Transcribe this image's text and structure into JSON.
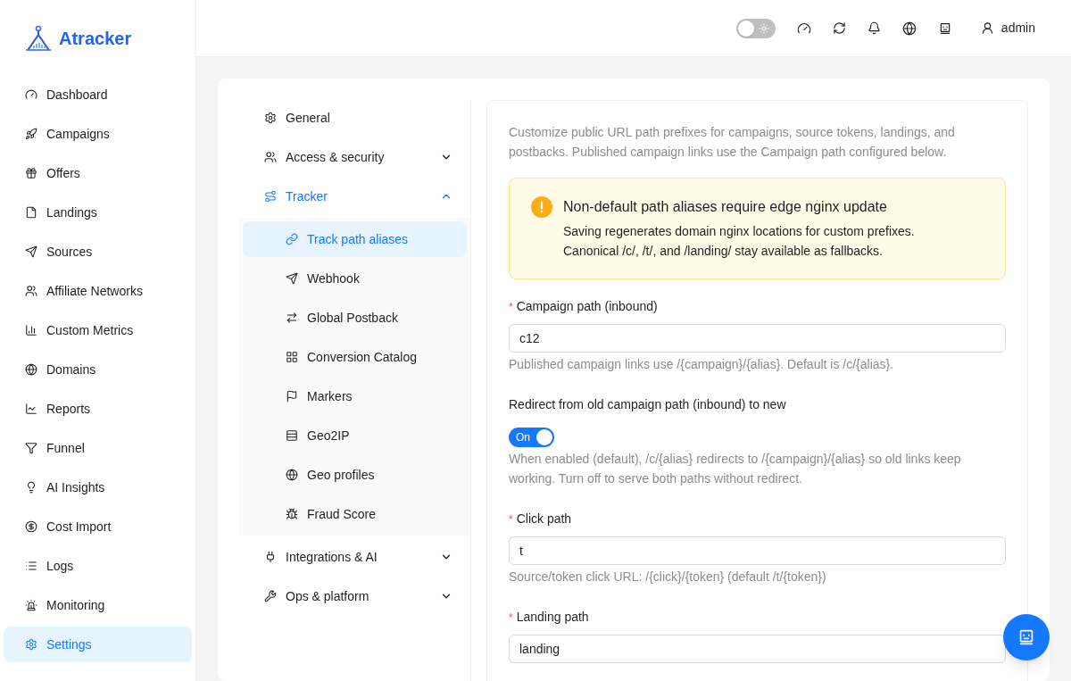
{
  "brand": {
    "name": "Atracker"
  },
  "sidebar": {
    "items": [
      {
        "label": "Dashboard",
        "selected": false
      },
      {
        "label": "Campaigns",
        "selected": false
      },
      {
        "label": "Offers",
        "selected": false
      },
      {
        "label": "Landings",
        "selected": false
      },
      {
        "label": "Sources",
        "selected": false
      },
      {
        "label": "Affiliate Networks",
        "selected": false
      },
      {
        "label": "Custom Metrics",
        "selected": false
      },
      {
        "label": "Domains",
        "selected": false
      },
      {
        "label": "Reports",
        "selected": false
      },
      {
        "label": "Funnel",
        "selected": false
      },
      {
        "label": "AI Insights",
        "selected": false
      },
      {
        "label": "Cost Import",
        "selected": false
      },
      {
        "label": "Logs",
        "selected": false
      },
      {
        "label": "Monitoring",
        "selected": false
      },
      {
        "label": "Settings",
        "selected": true
      }
    ]
  },
  "header": {
    "theme_toggle": {
      "on": false
    },
    "user": "admin"
  },
  "settings_nav": [
    {
      "label": "General",
      "selected": false
    },
    {
      "label": "Access & security",
      "selected": false,
      "expanded": false
    },
    {
      "label": "Tracker",
      "selected": true,
      "expanded": true,
      "children": [
        {
          "label": "Track path aliases",
          "selected": true
        },
        {
          "label": "Webhook",
          "selected": false
        },
        {
          "label": "Global Postback",
          "selected": false
        },
        {
          "label": "Conversion Catalog",
          "selected": false
        },
        {
          "label": "Markers",
          "selected": false
        },
        {
          "label": "Geo2IP",
          "selected": false
        },
        {
          "label": "Geo profiles",
          "selected": false
        },
        {
          "label": "Fraud Score",
          "selected": false
        }
      ]
    },
    {
      "label": "Integrations & AI",
      "selected": false,
      "expanded": false
    },
    {
      "label": "Ops & platform",
      "selected": false,
      "expanded": false
    }
  ],
  "content": {
    "intro": "Customize public URL path prefixes for campaigns, source tokens, landings, and postbacks. Published campaign links use the Campaign path configured below.",
    "alert": {
      "title": "Non-default path aliases require edge nginx update",
      "lines": [
        "Saving regenerates domain nginx locations for custom prefixes.",
        "Canonical /c/, /t/, and /landing/ stay available as fallbacks."
      ]
    },
    "fields": [
      {
        "kind": "input",
        "label": "Campaign path (inbound)",
        "required_mark": "*",
        "value": "c12",
        "help": "Published campaign links use /{campaign}/{alias}. Default is /c/{alias}."
      },
      {
        "kind": "switch",
        "label": "Redirect from old campaign path (inbound) to new",
        "on": true,
        "switch_text": "On",
        "help": "When enabled (default), /c/{alias} redirects to /{campaign}/{alias} so old links keep working. Turn off to serve both paths without redirect."
      },
      {
        "kind": "input",
        "label": "Click path",
        "required_mark": "*",
        "value": "t",
        "help": "Source/token click URL: /{click}/{token} (default /t/{token})"
      },
      {
        "kind": "input",
        "label": "Landing path",
        "required_mark": "*",
        "value": "landing"
      }
    ]
  }
}
